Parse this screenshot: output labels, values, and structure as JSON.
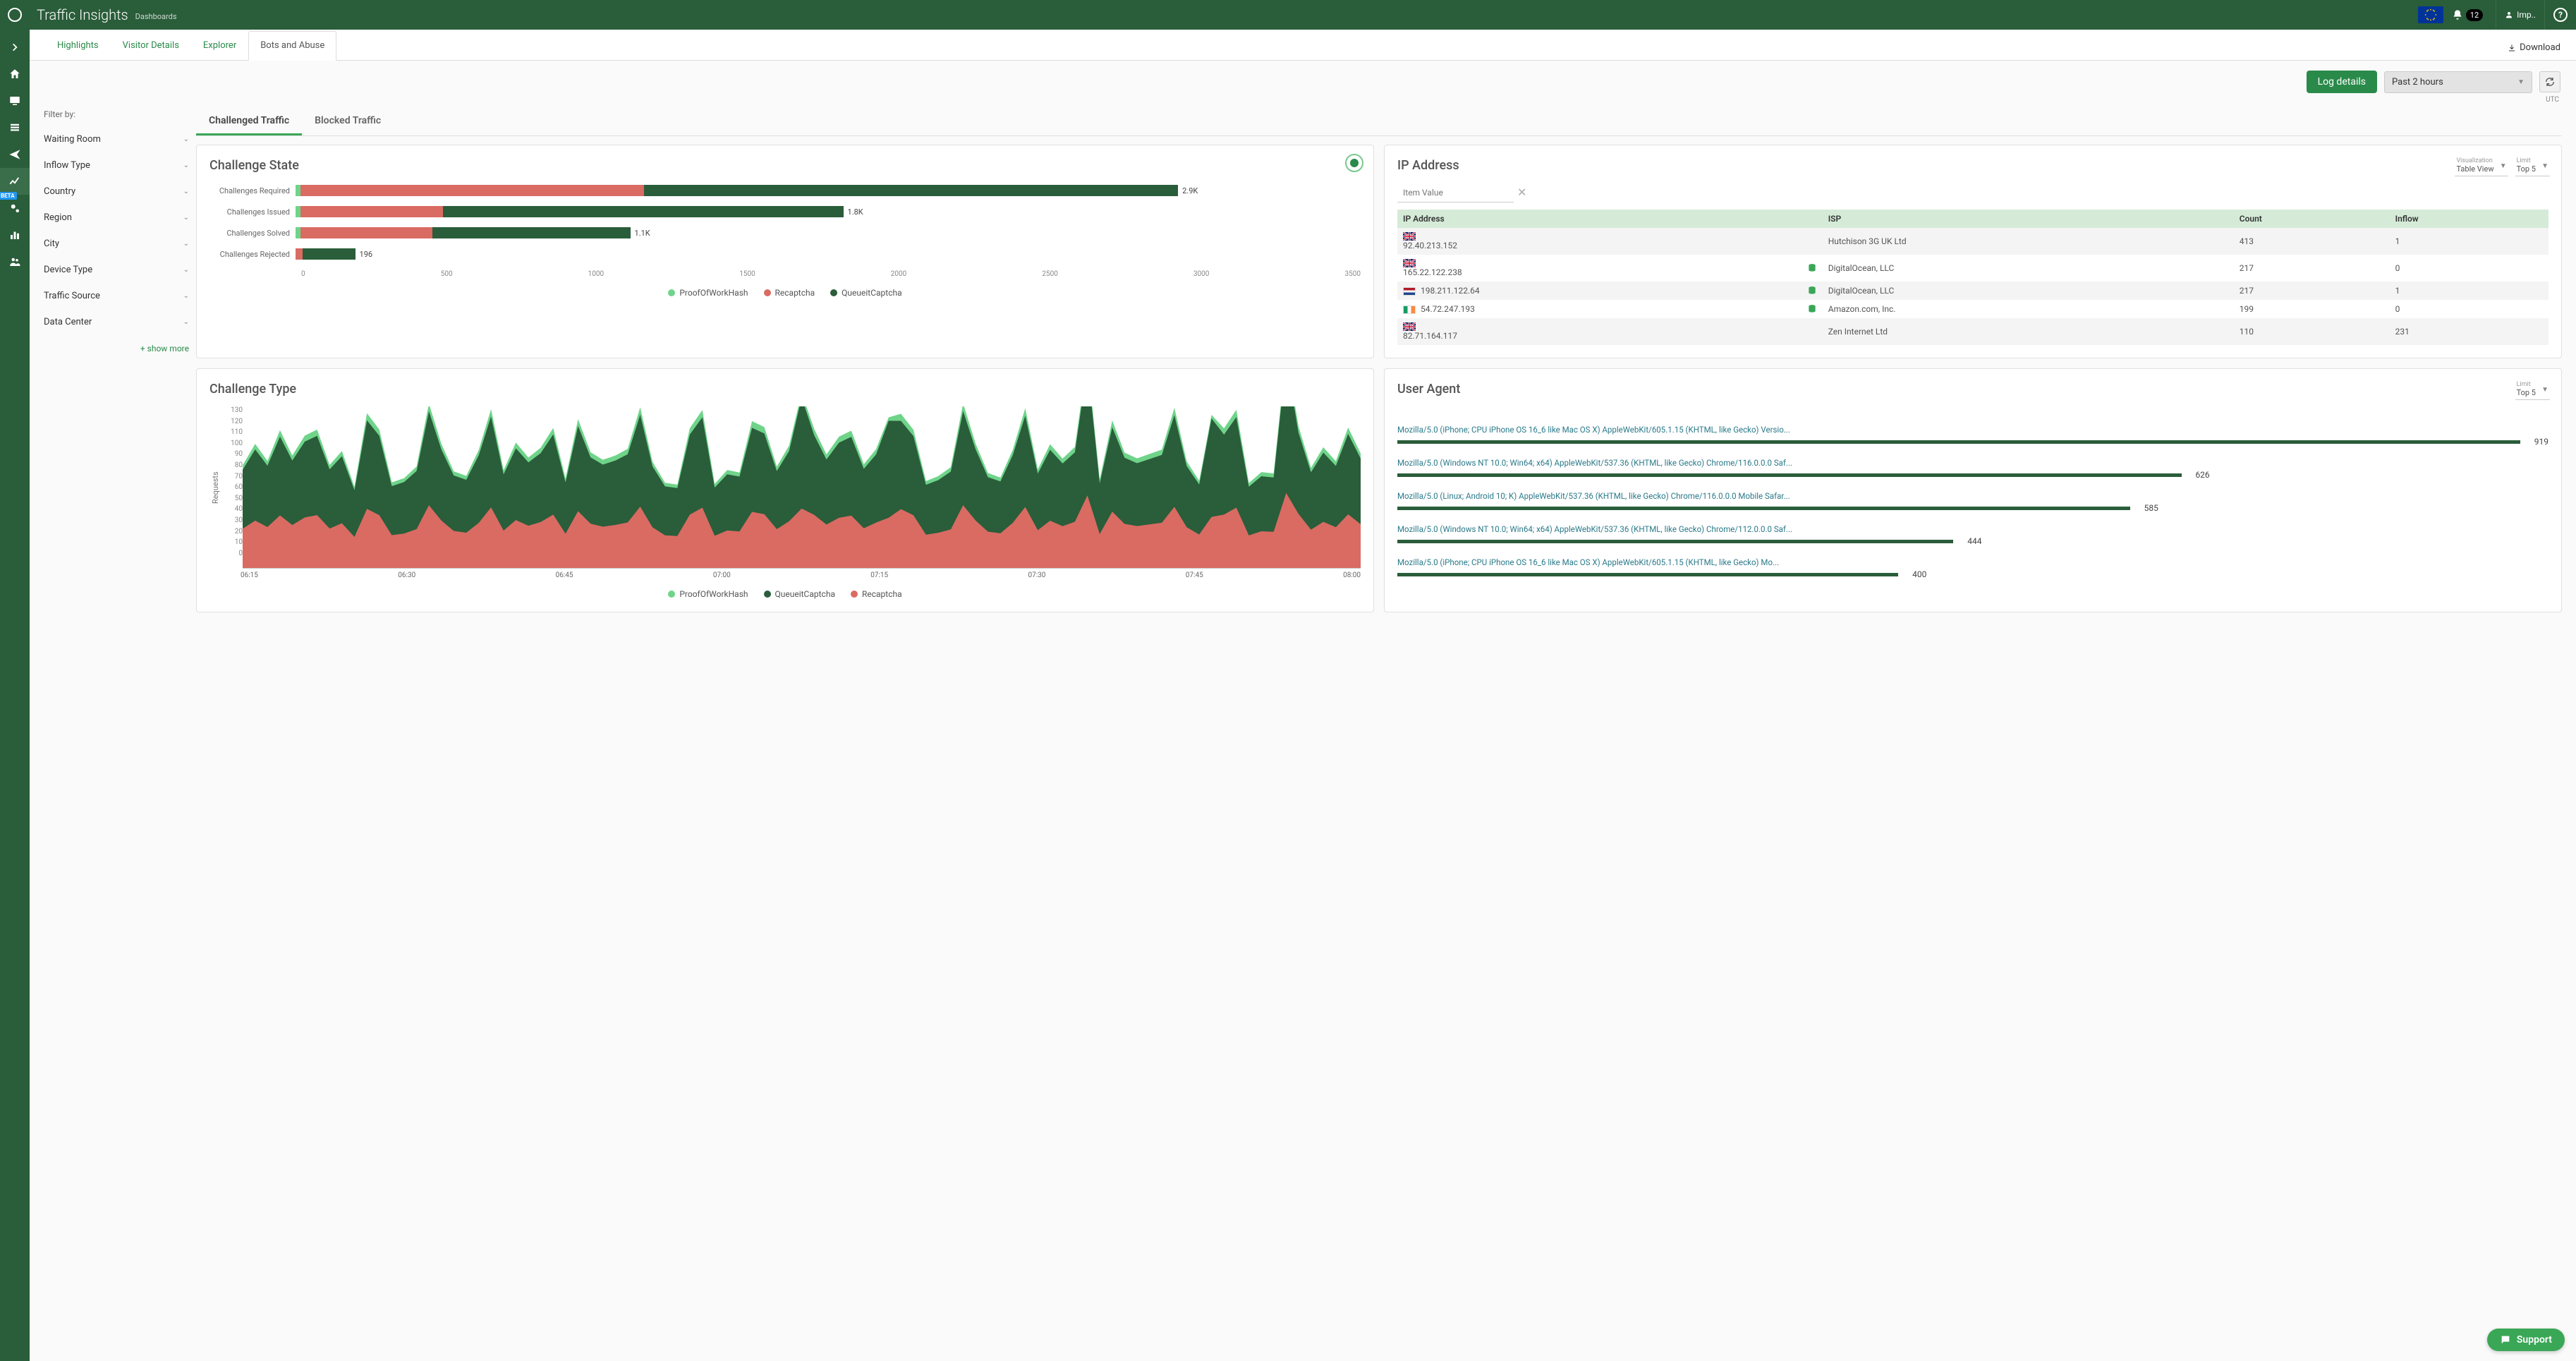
{
  "header": {
    "title": "Traffic Insights",
    "subtitle": "Dashboards",
    "notification_count": "12",
    "user_label": "Imp..",
    "flag_region": "EU"
  },
  "sidenav": {
    "items": [
      "expand",
      "home",
      "monitor",
      "list",
      "send",
      "analytics",
      "admin-beta",
      "stats",
      "users"
    ],
    "beta_label": "BETA"
  },
  "tabs": {
    "items": [
      "Highlights",
      "Visitor Details",
      "Explorer",
      "Bots and Abuse"
    ],
    "active_index": 3,
    "download_label": "Download"
  },
  "actions": {
    "log_details": "Log details",
    "time_range": "Past 2 hours",
    "timezone": "UTC"
  },
  "filters": {
    "label": "Filter by:",
    "items": [
      "Waiting Room",
      "Inflow Type",
      "Country",
      "Region",
      "City",
      "Device Type",
      "Traffic Source",
      "Data Center"
    ],
    "show_more": "+ show more"
  },
  "inner_tabs": {
    "items": [
      "Challenged Traffic",
      "Blocked Traffic"
    ],
    "active_index": 0
  },
  "challenge_state": {
    "title": "Challenge State",
    "legend": [
      "ProofOfWorkHash",
      "Recaptcha",
      "QueueitCaptcha"
    ],
    "colors": {
      "ProofOfWorkHash": "#6fd48a",
      "Recaptcha": "#d96b63",
      "QueueitCaptcha": "#2a5d3a"
    },
    "axis_ticks": [
      "0",
      "500",
      "1000",
      "1500",
      "2000",
      "2500",
      "3000",
      "3500"
    ]
  },
  "chart_data": {
    "challenge_state": {
      "type": "bar",
      "orientation": "horizontal",
      "stacked": true,
      "xmax": 3500,
      "series_names": [
        "ProofOfWorkHash",
        "Recaptcha",
        "QueueitCaptcha"
      ],
      "categories": [
        "Challenges Required",
        "Challenges Issued",
        "Challenges Solved",
        "Challenges Rejected"
      ],
      "values": [
        [
          16,
          1130,
          1754
        ],
        [
          16,
          468,
          1316
        ],
        [
          16,
          434,
          650
        ],
        [
          0,
          24,
          172
        ]
      ],
      "totals_label": [
        "2.9K",
        "1.8K",
        "1.1K",
        "196"
      ]
    },
    "challenge_type": {
      "type": "area",
      "stacked": true,
      "ylabel": "Requests",
      "ylim": [
        0,
        130
      ],
      "x_ticks": [
        "06:15",
        "06:30",
        "06:45",
        "07:00",
        "07:15",
        "07:30",
        "07:45",
        "08:00"
      ],
      "series": [
        {
          "name": "Recaptcha",
          "color": "#d96b63"
        },
        {
          "name": "QueueitCaptcha",
          "color": "#2a5d3a"
        },
        {
          "name": "ProofOfWorkHash",
          "color": "#6fd48a"
        }
      ],
      "note": "visually spiky stacked area; approximate peaks ~120 around 07:18, ~115 around 07:48"
    },
    "user_agent": {
      "type": "bar",
      "max": 919,
      "items": [
        {
          "label": "Mozilla/5.0 (iPhone; CPU iPhone OS 16_6 like Mac OS X) AppleWebKit/605.1.15 (KHTML, like Gecko) Versio...",
          "value": 919
        },
        {
          "label": "Mozilla/5.0 (Windows NT 10.0; Win64; x64) AppleWebKit/537.36 (KHTML, like Gecko) Chrome/116.0.0.0 Saf...",
          "value": 626
        },
        {
          "label": "Mozilla/5.0 (Linux; Android 10; K) AppleWebKit/537.36 (KHTML, like Gecko) Chrome/116.0.0.0 Mobile Safar...",
          "value": 585
        },
        {
          "label": "Mozilla/5.0 (Windows NT 10.0; Win64; x64) AppleWebKit/537.36 (KHTML, like Gecko) Chrome/112.0.0.0 Saf...",
          "value": 444
        },
        {
          "label": "Mozilla/5.0 (iPhone; CPU iPhone OS 16_6 like Mac OS X) AppleWebKit/605.1.15 (KHTML, like Gecko) Mo...",
          "value": 400
        }
      ]
    }
  },
  "ip_panel": {
    "title": "IP Address",
    "search_placeholder": "Item Value",
    "viz_label": "Visualization",
    "viz_value": "Table View",
    "limit_label": "Limit",
    "limit_value": "Top 5",
    "columns": [
      "IP Address",
      "ISP",
      "Count",
      "Inflow"
    ],
    "rows": [
      {
        "flag": "gb",
        "ip": "92.40.213.152",
        "db": false,
        "isp": "Hutchison 3G UK Ltd",
        "count": "413",
        "inflow": "1"
      },
      {
        "flag": "gb",
        "ip": "165.22.122.238",
        "db": true,
        "isp": "DigitalOcean, LLC",
        "count": "217",
        "inflow": "0"
      },
      {
        "flag": "nl",
        "ip": "198.211.122.64",
        "db": true,
        "isp": "DigitalOcean, LLC",
        "count": "217",
        "inflow": "1"
      },
      {
        "flag": "ie",
        "ip": "54.72.247.193",
        "db": true,
        "isp": "Amazon.com, Inc.",
        "count": "199",
        "inflow": "0"
      },
      {
        "flag": "gb",
        "ip": "82.71.164.117",
        "db": false,
        "isp": "Zen Internet Ltd",
        "count": "110",
        "inflow": "231"
      }
    ]
  },
  "challenge_type_panel": {
    "title": "Challenge Type",
    "legend": [
      "ProofOfWorkHash",
      "QueueitCaptcha",
      "Recaptcha"
    ]
  },
  "user_agent_panel": {
    "title": "User Agent",
    "limit_label": "Limit",
    "limit_value": "Top 5"
  },
  "support_label": "Support"
}
